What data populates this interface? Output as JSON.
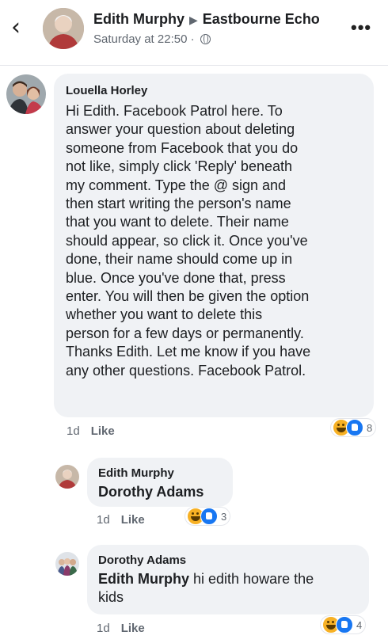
{
  "header": {
    "back_icon": "chevron-left-icon",
    "author": "Edith Murphy",
    "arrow_icon": "triangle-right-icon",
    "page": "Eastbourne Echo",
    "timestamp": "Saturday at 22:50 ·",
    "privacy_icon": "globe-icon",
    "more_icon": "more-dots-icon"
  },
  "comments": [
    {
      "author": "Louella Horley",
      "text_lines": [
        "Hi Edith. Facebook Patrol here. To",
        "answer your question about deleting",
        "someone from Facebook that you do",
        "not like, simply click 'Reply' beneath",
        "my comment. Type the @ sign and",
        "then start writing the person's name",
        "that you want to delete. Their name",
        "should appear, so click it. Once you've",
        "done, their name should come up in",
        "blue. Once you've done that, press",
        "enter. You will then be given the option",
        "whether you want to delete this",
        "person for a few days or permanently.",
        "Thanks Edith. Let me know if you have",
        "any other questions. Facebook Patrol."
      ],
      "time": "1d",
      "like_label": "Like",
      "reaction_count": "8"
    },
    {
      "author": "Edith Murphy",
      "mention": "Dorothy Adams",
      "text": "",
      "time": "1d",
      "like_label": "Like",
      "reaction_count": "3"
    },
    {
      "author": "Dorothy Adams",
      "mention": "Edith Murphy",
      "text_line1": " hi edith howare the",
      "text_line2": "kids",
      "time": "1d",
      "like_label": "Like",
      "reaction_count": "4"
    }
  ],
  "colors": {
    "bubble": "#f0f2f5",
    "meta_text": "#606770",
    "like_blue": "#1877f2",
    "haha_yellow": "#f7b125"
  }
}
